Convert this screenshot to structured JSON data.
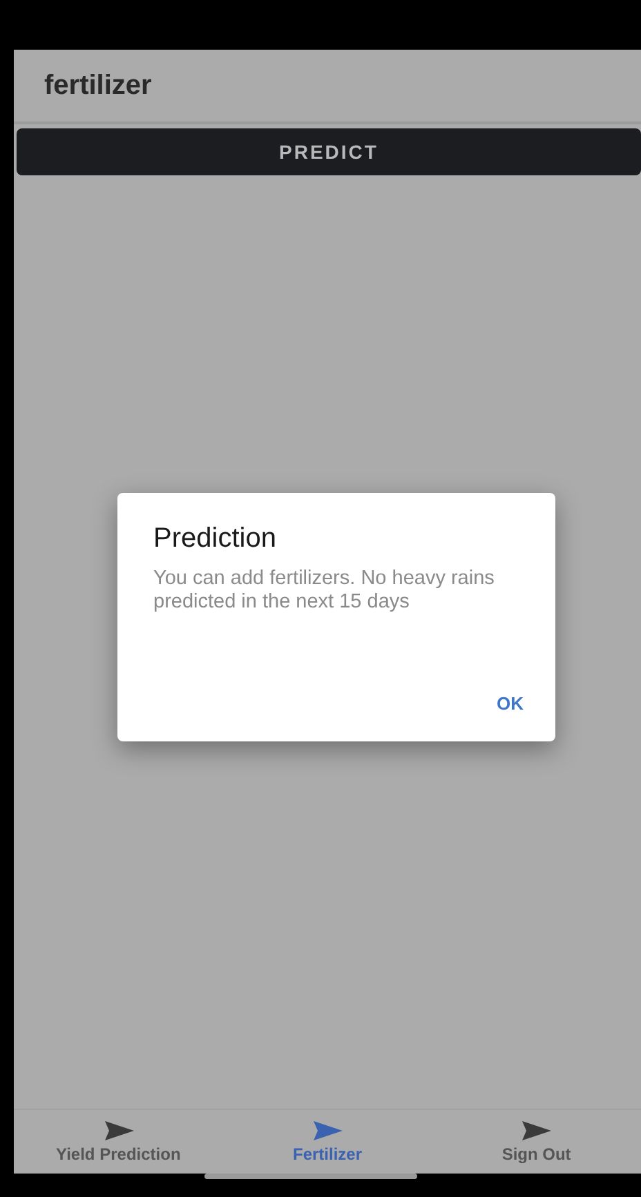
{
  "app_bar": {
    "title": "fertilizer"
  },
  "predict_button": {
    "label": "PREDICT"
  },
  "dialog": {
    "title": "Prediction",
    "message": "You can add fertilizers. No heavy rains predicted in the next 15 days",
    "actions": [
      "OK"
    ]
  },
  "bottom_nav": [
    {
      "label": "Yield Prediction",
      "selected": false
    },
    {
      "label": "Fertilizer",
      "selected": true
    },
    {
      "label": "Sign Out",
      "selected": false
    }
  ]
}
